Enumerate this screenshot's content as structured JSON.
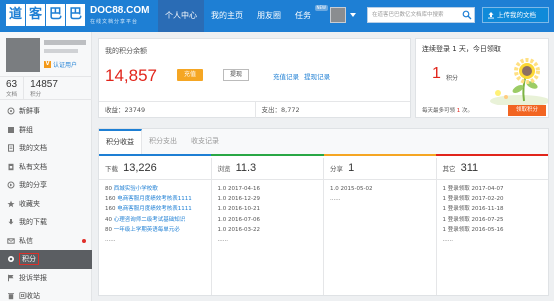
{
  "topbar": {
    "logo_chars": [
      "道",
      "客",
      "巴",
      "巴"
    ],
    "logo_en": "DOC88.COM",
    "logo_sub": "在线文档分享平台",
    "nav": [
      {
        "label": "个人中心",
        "active": true
      },
      {
        "label": "我的主页",
        "active": false
      },
      {
        "label": "朋友圈",
        "active": false
      },
      {
        "label": "任务",
        "active": false,
        "badge": "NEW"
      }
    ],
    "search_placeholder": "在道客巴巴数亿文档库中搜索",
    "upload_label": "上传我的文档"
  },
  "sidebar": {
    "verify_icon": "V",
    "verify_label": "认证用户",
    "stats": [
      {
        "value": "63",
        "label": "文档"
      },
      {
        "value": "14857",
        "label": "积分"
      }
    ],
    "menu": [
      {
        "label": "新鲜事",
        "icon": "fresh-icon"
      },
      {
        "label": "群组",
        "icon": "group-icon"
      },
      {
        "label": "我的文档",
        "icon": "document-icon"
      },
      {
        "label": "私有文档",
        "icon": "private-doc-icon"
      },
      {
        "label": "我的分享",
        "icon": "share-icon"
      },
      {
        "label": "收藏夹",
        "icon": "star-icon"
      },
      {
        "label": "我的下载",
        "icon": "download-icon"
      },
      {
        "label": "私信",
        "icon": "message-icon",
        "dot": true
      },
      {
        "label": "积分",
        "icon": "points-icon",
        "active": true
      },
      {
        "label": "投诉举报",
        "icon": "report-icon"
      },
      {
        "label": "回收站",
        "icon": "trash-icon"
      }
    ]
  },
  "balance": {
    "title": "我的积分余额",
    "value": "14,857",
    "recharge_label": "充值",
    "withdraw_label": "提现",
    "link_recharge": "充值记录",
    "link_withdraw": "提现记录",
    "income": "收益：23749",
    "expense": "支出：8,772"
  },
  "login": {
    "title": "连续登录 1 天，今日领取",
    "amount": "1",
    "unit": "积分",
    "note_prefix": "每天最多可领",
    "note_value": "1",
    "note_suffix": "次。",
    "claim_label": "领取积分"
  },
  "details": {
    "tabs": [
      {
        "label": "积分收益",
        "active": true
      },
      {
        "label": "积分支出",
        "active": false
      },
      {
        "label": "收支记录",
        "active": false
      }
    ],
    "stripe_colors": [
      "#1e7fd4",
      "#29a745",
      "#f5a623",
      "#e1251b"
    ],
    "columns": [
      {
        "title": "下载",
        "total": "13,226",
        "rows": [
          {
            "pts": "80",
            "text": "西城实验小学校歌"
          },
          {
            "pts": "160",
            "text": "电商客服月度绩效考核表1111"
          },
          {
            "pts": "160",
            "text": "电商客服月度绩效考核表1111"
          },
          {
            "pts": "40",
            "text": "心理咨询师二级考试基础知识"
          },
          {
            "pts": "80",
            "text": "一年级上学期英语每单元必"
          }
        ],
        "more": "......"
      },
      {
        "title": "浏览",
        "total": "11.3",
        "rows": [
          {
            "pts": "1.0",
            "text": "2017-04-16"
          },
          {
            "pts": "1.0",
            "text": "2016-12-29"
          },
          {
            "pts": "1.0",
            "text": "2016-10-21"
          },
          {
            "pts": "1.0",
            "text": "2016-07-06"
          },
          {
            "pts": "1.0",
            "text": "2016-03-22"
          }
        ],
        "more": "......"
      },
      {
        "title": "分享",
        "total": "1",
        "rows": [
          {
            "pts": "1.0",
            "text": "2015-05-02"
          }
        ],
        "more": "......"
      },
      {
        "title": "其它",
        "total": "311",
        "rows": [
          {
            "pts": "1",
            "text": "登录领取 2017-04-07"
          },
          {
            "pts": "1",
            "text": "登录领取 2017-02-20"
          },
          {
            "pts": "1",
            "text": "登录领取 2016-11-18"
          },
          {
            "pts": "1",
            "text": "登录领取 2016-07-25"
          },
          {
            "pts": "1",
            "text": "登录领取 2016-05-16"
          }
        ],
        "more": "......"
      }
    ]
  }
}
